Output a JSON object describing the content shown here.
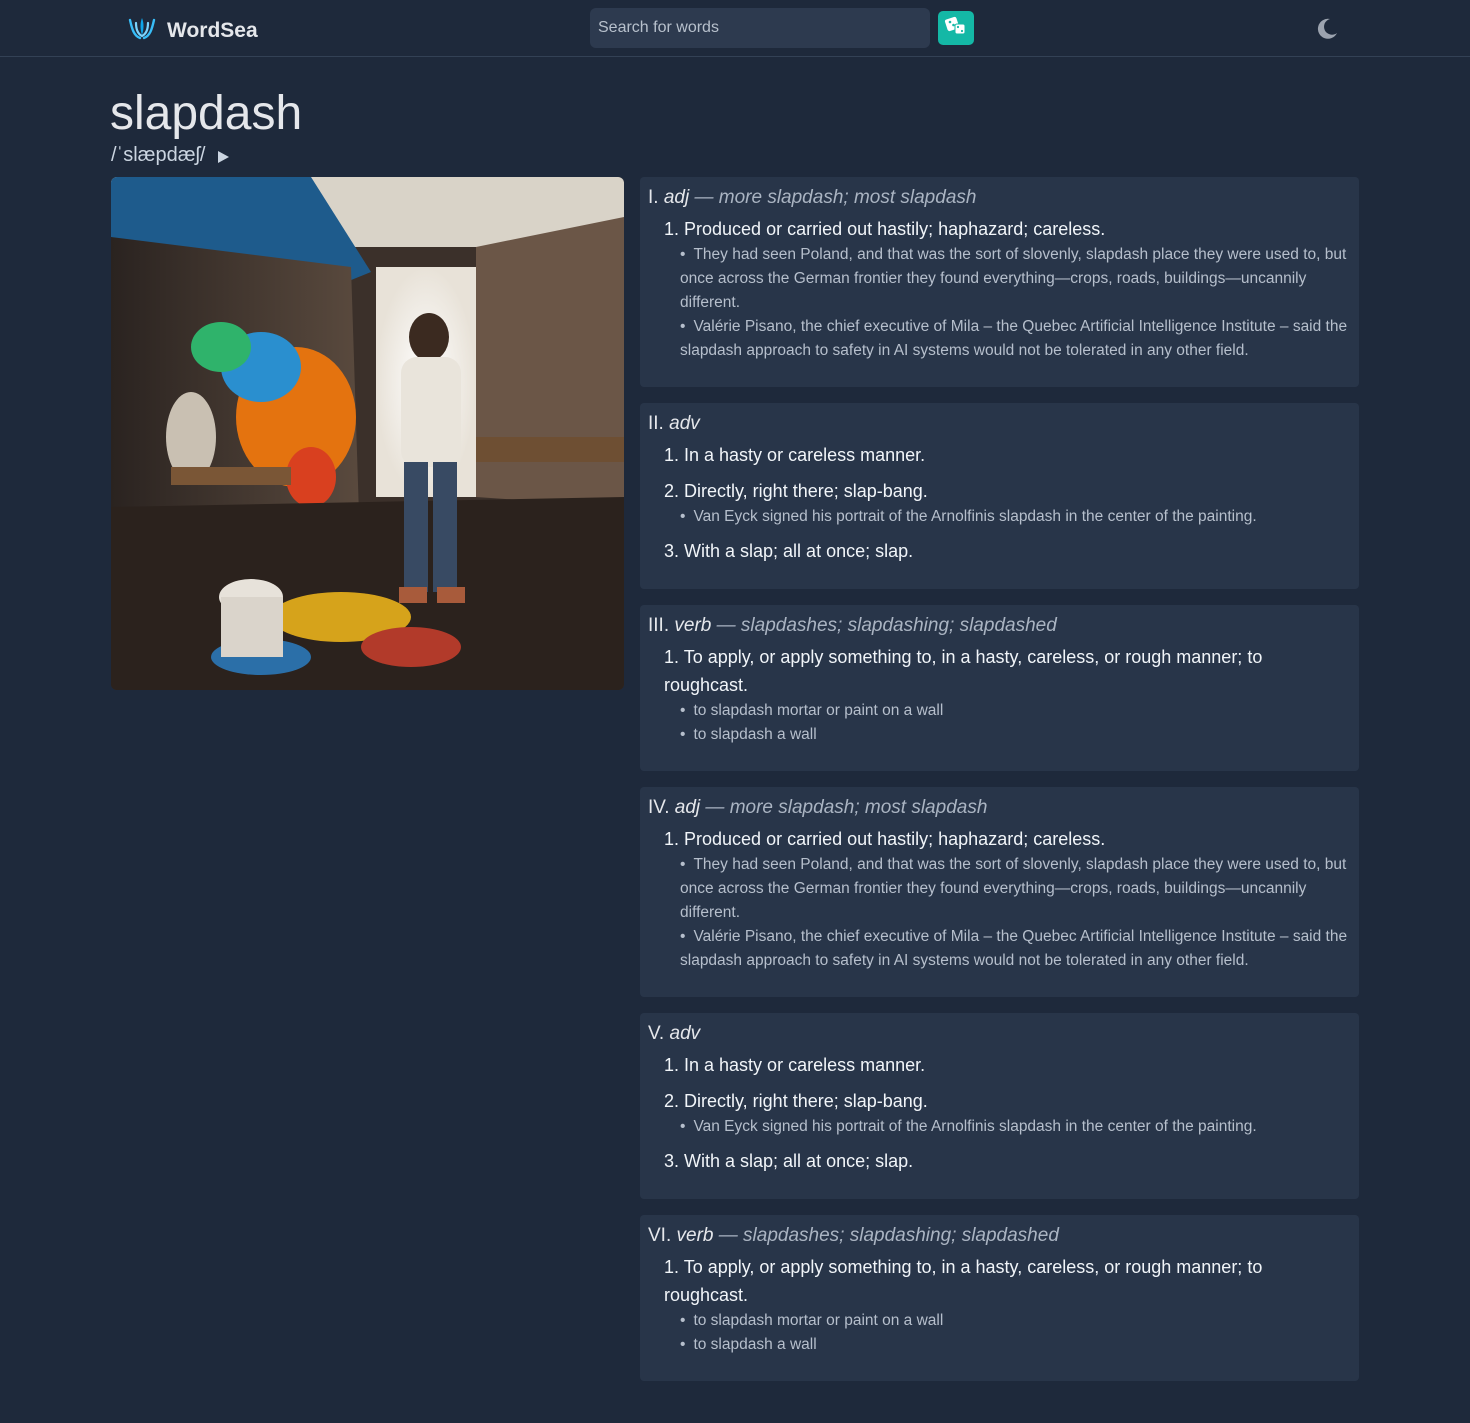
{
  "header": {
    "brand": "WordSea",
    "search_placeholder": "Search for words",
    "logo_icon": "wave-logo-icon",
    "random_icon": "dice-icon",
    "theme_icon": "moon-icon"
  },
  "word": {
    "title": "slapdash",
    "phonetic": "/ˈslæpdæʃ/",
    "play_icon": "play-icon",
    "image_alt": "painter-in-messy-studio-illustration"
  },
  "entries": [
    {
      "numeral": "I.",
      "pos": "adj",
      "forms": "— more slapdash; most slapdash",
      "senses": [
        {
          "text": "1. Produced or carried out hastily; haphazard; careless.",
          "examples": [
            "They had seen Poland, and that was the sort of slovenly, slapdash place they were used to, but once across the German frontier they found everything—crops, roads, buildings—uncannily different.",
            "Valérie Pisano, the chief executive of Mila – the Quebec Artificial Intelligence Institute – said the slapdash approach to safety in AI systems would not be tolerated in any other field."
          ]
        }
      ]
    },
    {
      "numeral": "II.",
      "pos": "adv",
      "forms": "",
      "senses": [
        {
          "text": "1. In a hasty or careless manner.",
          "examples": []
        },
        {
          "text": "2. Directly, right there; slap-bang.",
          "examples": [
            "Van Eyck signed his portrait of the Arnolfinis slapdash in the center of the painting."
          ]
        },
        {
          "text": "3. With a slap; all at once; slap.",
          "examples": []
        }
      ]
    },
    {
      "numeral": "III.",
      "pos": "verb",
      "forms": "— slapdashes; slapdashing; slapdashed",
      "senses": [
        {
          "text": "1. To apply, or apply something to, in a hasty, careless, or rough manner; to roughcast.",
          "examples": [
            "to slapdash mortar or paint on a wall",
            "to slapdash a wall"
          ]
        }
      ]
    },
    {
      "numeral": "IV.",
      "pos": "adj",
      "forms": "— more slapdash; most slapdash",
      "senses": [
        {
          "text": "1. Produced or carried out hastily; haphazard; careless.",
          "examples": [
            "They had seen Poland, and that was the sort of slovenly, slapdash place they were used to, but once across the German frontier they found everything—crops, roads, buildings—uncannily different.",
            "Valérie Pisano, the chief executive of Mila – the Quebec Artificial Intelligence Institute – said the slapdash approach to safety in AI systems would not be tolerated in any other field."
          ]
        }
      ]
    },
    {
      "numeral": "V.",
      "pos": "adv",
      "forms": "",
      "senses": [
        {
          "text": "1. In a hasty or careless manner.",
          "examples": []
        },
        {
          "text": "2. Directly, right there; slap-bang.",
          "examples": [
            "Van Eyck signed his portrait of the Arnolfinis slapdash in the center of the painting."
          ]
        },
        {
          "text": "3. With a slap; all at once; slap.",
          "examples": []
        }
      ]
    },
    {
      "numeral": "VI.",
      "pos": "verb",
      "forms": "— slapdashes; slapdashing; slapdashed",
      "senses": [
        {
          "text": "1. To apply, or apply something to, in a hasty, careless, or rough manner; to roughcast.",
          "examples": [
            "to slapdash mortar or paint on a wall",
            "to slapdash a wall"
          ]
        }
      ]
    }
  ],
  "colors": {
    "background": "#1e293b",
    "card": "#283549",
    "accent": "#14b8a6"
  }
}
